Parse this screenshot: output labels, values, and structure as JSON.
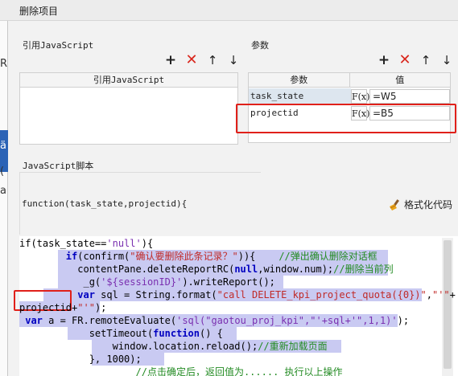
{
  "window": {
    "title": "删除项目"
  },
  "left_strip": {
    "fragments": [
      "R",
      "ä",
      "(",
      "a"
    ]
  },
  "js_ref_panel": {
    "title": "引用JavaScript",
    "column_header": "引用JavaScript"
  },
  "params_panel": {
    "title": "参数",
    "columns": [
      "参数",
      "值"
    ],
    "rows": [
      {
        "name": "task_state",
        "fx": "F(x)",
        "value": "=W5"
      },
      {
        "name": "projectid",
        "fx": "F(x)",
        "value": "=B5"
      }
    ]
  },
  "toolbar": {
    "icons": [
      "plus-icon",
      "delete-icon",
      "arrow-up-icon",
      "arrow-down-icon"
    ],
    "glyphs": {
      "plus": "+",
      "delete": "✕",
      "up": "↑",
      "down": "↓"
    }
  },
  "script_panel": {
    "title": "JavaScript脚本",
    "function_signature": "function(task_state,projectid){",
    "format_button_label": "格式化代码",
    "code_lines": [
      [
        [
          "if(task_state==",
          ""
        ],
        [
          "'null'",
          "str2"
        ],
        [
          "){",
          ""
        ]
      ],
      [
        [
          "        ",
          ""
        ],
        [
          "if",
          "kw"
        ],
        [
          "(confirm(",
          ""
        ],
        [
          "\"确认要删除此条记录？\"",
          "str"
        ],
        [
          ")){    ",
          ""
        ],
        [
          "//弹出确认删除对话框",
          "cmt"
        ]
      ],
      [
        [
          "          contentPane.deleteReportRC(",
          ""
        ],
        [
          "null",
          "kw"
        ],
        [
          ",window.num);",
          ""
        ],
        [
          "//删除当前列",
          "cmt"
        ]
      ],
      [
        [
          "           _g(",
          ""
        ],
        [
          "'${sessionID}'",
          "str2"
        ],
        [
          ").writeReport();",
          ""
        ]
      ],
      [
        [
          "          ",
          ""
        ],
        [
          "var",
          "kw"
        ],
        [
          " sql = String.format(",
          ""
        ],
        [
          "\"call DELETE_kpi_project_quota({0})\"",
          "str"
        ],
        [
          ",",
          ""
        ],
        [
          "\"'\"",
          "str"
        ],
        [
          "+",
          ""
        ]
      ],
      [
        [
          "projectid",
          ""
        ],
        [
          "+",
          ""
        ],
        [
          "\"'\"",
          "str"
        ],
        [
          ");",
          ""
        ]
      ],
      [
        [
          " ",
          ""
        ],
        [
          "var",
          "kw"
        ],
        [
          " a = FR.remoteEvaluate(",
          ""
        ],
        [
          "'sql(\"gaotou_proj_kpi\",\"'+sql+'\",1,1)'",
          "str2"
        ],
        [
          ");",
          ""
        ]
      ],
      [
        [
          "            setTimeout(",
          ""
        ],
        [
          "function",
          "kw"
        ],
        [
          "() {",
          ""
        ]
      ],
      [
        [
          "                window.location.reload();",
          ""
        ],
        [
          "//重新加载页面",
          "cmt"
        ]
      ],
      [
        [
          "            }, 1000);",
          ""
        ]
      ],
      [
        [
          "                    ",
          ""
        ],
        [
          "//点击确定后，返回值为...... 执行以上操作",
          "cmt"
        ]
      ]
    ]
  },
  "colors": {
    "selection": "#c9caf2",
    "keyword": "#0000c0",
    "string": "#c02a28",
    "comment": "#238b23",
    "annotation_red": "#e0201a"
  }
}
